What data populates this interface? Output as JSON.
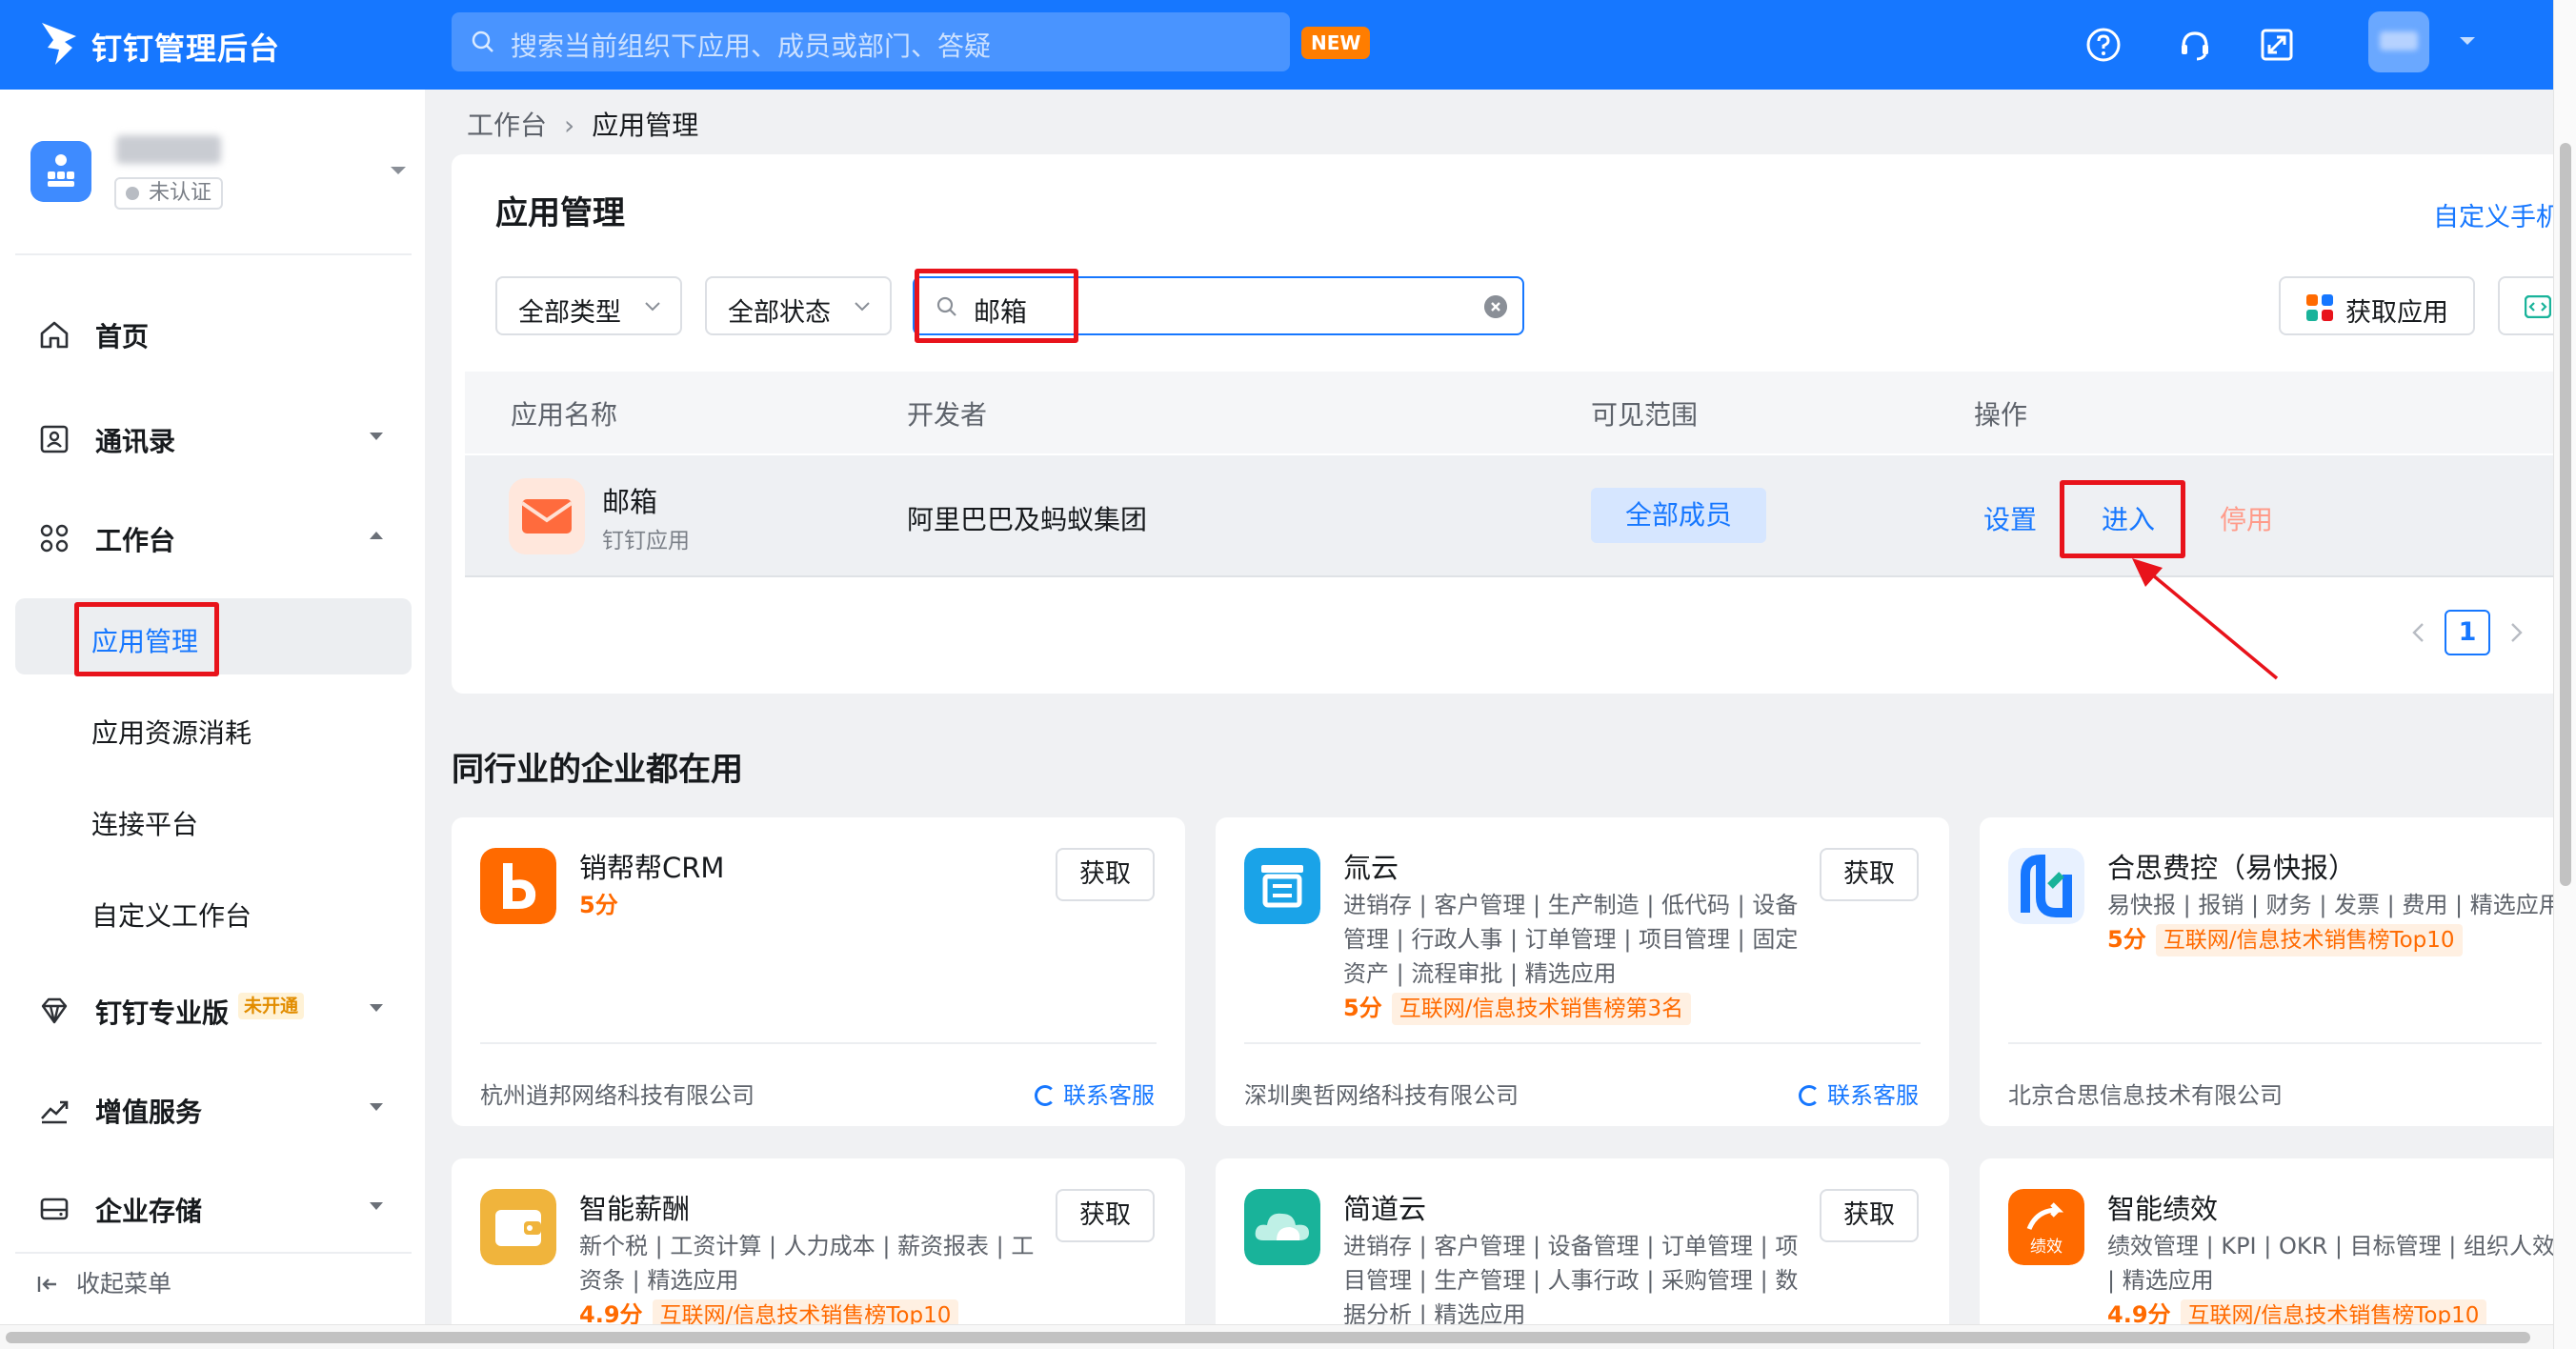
{
  "topbar": {
    "brand": "钉钉管理后台",
    "search_placeholder": "搜索当前组织下应用、成员或部门、答疑",
    "new_badge": "NEW"
  },
  "org": {
    "cert_tag": "未认证"
  },
  "nav": {
    "home": "首页",
    "contacts": "通讯录",
    "workbench": "工作台",
    "sub_app_manage": "应用管理",
    "sub_resource": "应用资源消耗",
    "sub_connect": "连接平台",
    "sub_custom": "自定义工作台",
    "pro": "钉钉专业版",
    "pro_badge": "未开通",
    "value_added": "增值服务",
    "storage": "企业存储",
    "collapse": "收起菜单"
  },
  "breadcrumb": {
    "root": "工作台",
    "current": "应用管理"
  },
  "main": {
    "title": "应用管理",
    "custom_link": "自定义手机",
    "filter_type": "全部类型",
    "filter_status": "全部状态",
    "search_value": "邮箱",
    "get_app": "获取应用"
  },
  "table": {
    "headers": [
      "应用名称",
      "开发者",
      "可见范围",
      "操作"
    ],
    "rows": [
      {
        "name": "邮箱",
        "subtitle": "钉钉应用",
        "developer": "阿里巴巴及蚂蚁集团",
        "scope": "全部成员",
        "op_settings": "设置",
        "op_enter": "进入",
        "op_disable": "停用"
      }
    ]
  },
  "pagination": {
    "current": "1"
  },
  "recommend": {
    "title": "同行业的企业都在用",
    "get_label": "获取",
    "service_label": "联系客服",
    "cards": [
      {
        "name": "销帮帮CRM",
        "tags": "",
        "score": "5分",
        "rank": "",
        "company": "杭州逍邦网络科技有限公司",
        "color": "#ff6a00"
      },
      {
        "name": "氚云",
        "tags": "进销存 | 客户管理 | 生产制造 | 低代码 | 设备管理 | 行政人事 | 订单管理 | 项目管理 | 固定资产 | 流程审批 | 精选应用",
        "score": "5分",
        "rank": "互联网/信息技术销售榜第3名",
        "company": "深圳奥哲网络科技有限公司",
        "color": "#1aa3e8"
      },
      {
        "name": "合思费控（易快报）",
        "tags": "易快报 | 报销 | 财务 | 发票 | 费用 | 精选应用",
        "score": "5分",
        "rank": "互联网/信息技术销售榜Top10",
        "company": "北京合思信息技术有限公司",
        "color": "#1677ff"
      },
      {
        "name": "智能薪酬",
        "tags": "新个税 | 工资计算 | 人力成本 | 薪资报表 | 工资条 | 精选应用",
        "score": "4.9分",
        "rank": "互联网/信息技术销售榜Top10",
        "company": "",
        "color": "#f0b43c"
      },
      {
        "name": "简道云",
        "tags": "进销存 | 客户管理 | 设备管理 | 订单管理 | 项目管理 | 生产管理 | 人事行政 | 采购管理 | 数据分析 | 精选应用",
        "score": "",
        "rank": "",
        "company": "",
        "color": "#19b39a"
      },
      {
        "name": "智能绩效",
        "tags": "绩效管理 | KPI | OKR | 目标管理 | 组织人效 | 精选应用",
        "score": "4.9分",
        "rank": "互联网/信息技术销售榜Top10",
        "company": "",
        "color": "#ff6a00",
        "icon_text": "绩效"
      }
    ]
  }
}
